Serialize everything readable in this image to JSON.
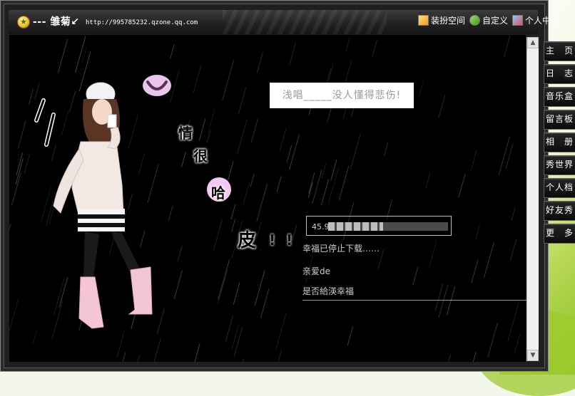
{
  "window": {
    "space_name": "--- 雏菊↙",
    "url": "http://995785232.qzone.qq.com"
  },
  "toolbar": {
    "links": [
      {
        "label": "装扮空间",
        "icon": "dress-up-icon"
      },
      {
        "label": "自定义",
        "icon": "customize-icon"
      },
      {
        "label": "个人中心",
        "icon": "personal-center-icon"
      }
    ]
  },
  "sidebar": {
    "items": [
      {
        "label": "主　页"
      },
      {
        "label": "日　志"
      },
      {
        "label": "音乐盒"
      },
      {
        "label": "留言板"
      },
      {
        "label": "相　册"
      },
      {
        "label": "秀世界"
      },
      {
        "label": "个人档"
      },
      {
        "label": "好友秀"
      },
      {
        "label": "更　多"
      }
    ]
  },
  "main": {
    "banner_text": "浅唱_____没人懂得悲伤!",
    "decor_chars": [
      "情",
      "很",
      "哈",
      "皮",
      "!",
      "!"
    ],
    "music": {
      "progress_label": "45.9",
      "progress": 0.459,
      "status": "幸福已停止下载……",
      "line1": "亲爱de",
      "line2": "是否給渶幸福"
    }
  },
  "colors": {
    "stage_bg": "#000000",
    "accent_green": "#8fc227",
    "banner_text": "#9a9a9a"
  }
}
